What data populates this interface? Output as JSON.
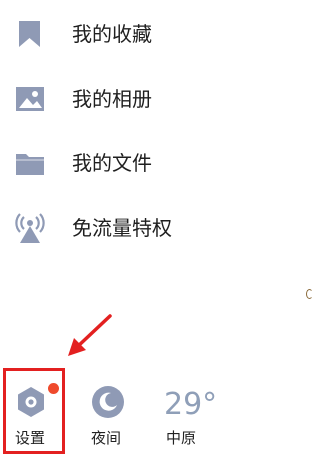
{
  "menu": {
    "items": [
      {
        "label": "我的收藏",
        "icon": "bookmark-icon"
      },
      {
        "label": "我的相册",
        "icon": "image-icon"
      },
      {
        "label": "我的文件",
        "icon": "folder-icon"
      },
      {
        "label": "免流量特权",
        "icon": "signal-tower-icon"
      }
    ]
  },
  "bottom_bar": {
    "settings_label": "设置",
    "settings_icon": "gear-icon",
    "night_label": "夜间",
    "night_icon": "moon-icon",
    "weather_temp": "29°",
    "weather_city": "中原"
  },
  "colors": {
    "icon": "#8f9ab5",
    "text": "#1f1f1f",
    "highlight": "#e32020",
    "badge": "#ef4a2c"
  }
}
